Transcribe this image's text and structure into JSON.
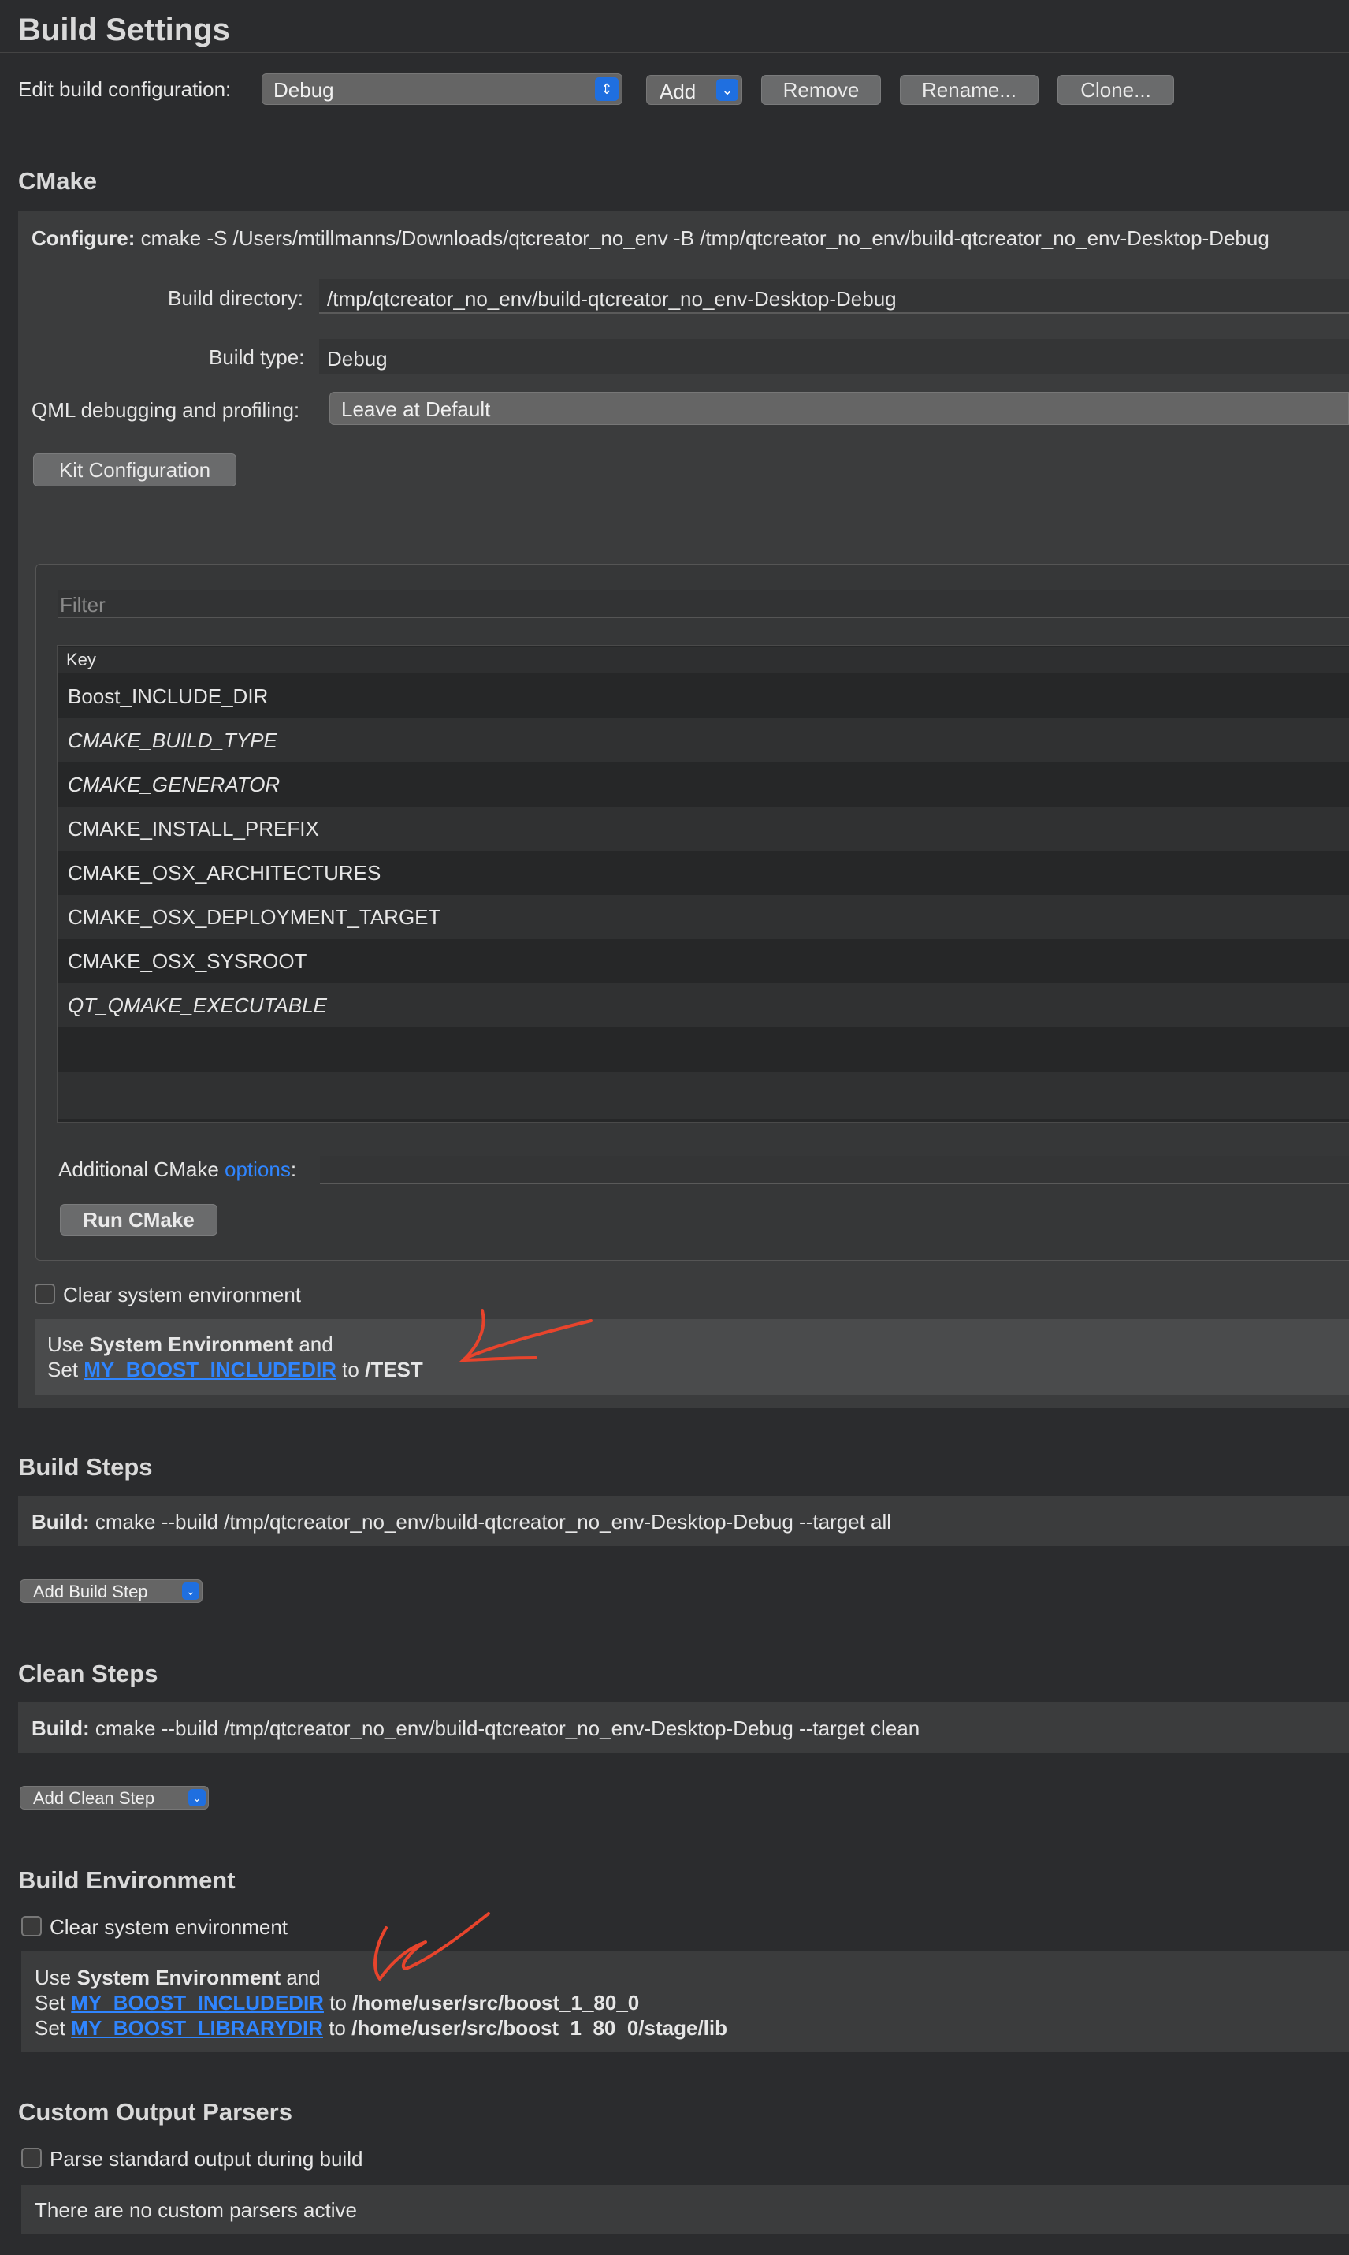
{
  "page": {
    "title": "Build Settings"
  },
  "config": {
    "label": "Edit build configuration:",
    "selected": "Debug",
    "add_label": "Add",
    "remove_label": "Remove",
    "rename_label": "Rename...",
    "clone_label": "Clone..."
  },
  "cmake": {
    "heading": "CMake",
    "configure_prefix": "Configure:",
    "configure_cmd": "cmake -S /Users/mtillmanns/Downloads/qtcreator_no_env -B /tmp/qtcreator_no_env/build-qtcreator_no_env-Desktop-Debug",
    "build_dir_label": "Build directory:",
    "build_dir_value": "/tmp/qtcreator_no_env/build-qtcreator_no_env-Desktop-Debug",
    "build_type_label": "Build type:",
    "build_type_value": "Debug",
    "qml_label": "QML debugging and profiling:",
    "qml_value": "Leave at Default",
    "kit_config_label": "Kit Configuration",
    "filter_placeholder": "Filter",
    "table_header": "Key",
    "keys": [
      "Boost_INCLUDE_DIR",
      "CMAKE_BUILD_TYPE",
      "CMAKE_GENERATOR",
      "CMAKE_INSTALL_PREFIX",
      "CMAKE_OSX_ARCHITECTURES",
      "CMAKE_OSX_DEPLOYMENT_TARGET",
      "CMAKE_OSX_SYSROOT",
      "QT_QMAKE_EXECUTABLE"
    ],
    "additional_prefix": "Additional CMake ",
    "additional_link": "options",
    "additional_suffix": ":",
    "run_cmake_label": "Run CMake",
    "clear_env_label": "Clear system environment",
    "env_line1_prefix": "Use ",
    "env_line1_bold": "System Environment",
    "env_line1_suffix": " and",
    "env_line2_prefix": "Set ",
    "env_line2_var": "MY_BOOST_INCLUDEDIR",
    "env_line2_mid": " to ",
    "env_line2_value": "/TEST"
  },
  "build_steps": {
    "heading": "Build Steps",
    "step_prefix": "Build:",
    "step_cmd": "cmake --build /tmp/qtcreator_no_env/build-qtcreator_no_env-Desktop-Debug --target all",
    "add_label": "Add Build Step"
  },
  "clean_steps": {
    "heading": "Clean Steps",
    "step_prefix": "Build:",
    "step_cmd": "cmake --build /tmp/qtcreator_no_env/build-qtcreator_no_env-Desktop-Debug --target clean",
    "add_label": "Add Clean Step"
  },
  "build_env": {
    "heading": "Build Environment",
    "clear_env_label": "Clear system environment",
    "line1_prefix": "Use ",
    "line1_bold": "System Environment",
    "line1_suffix": " and",
    "set_prefix": "Set ",
    "to_word": " to ",
    "var1": "MY_BOOST_INCLUDEDIR",
    "val1": "/home/user/src/boost_1_80_0",
    "var2": "MY_BOOST_LIBRARYDIR",
    "val2": "/home/user/src/boost_1_80_0/stage/lib"
  },
  "parsers": {
    "heading": "Custom Output Parsers",
    "parse_label": "Parse standard output during build",
    "none_label": "There are no custom parsers active"
  },
  "colors": {
    "background": "#2b2c2e",
    "panel": "#3b3c3d",
    "link": "#2f85ff",
    "accent_blue": "#1f6fe0",
    "annotation_red": "#e8442c"
  }
}
